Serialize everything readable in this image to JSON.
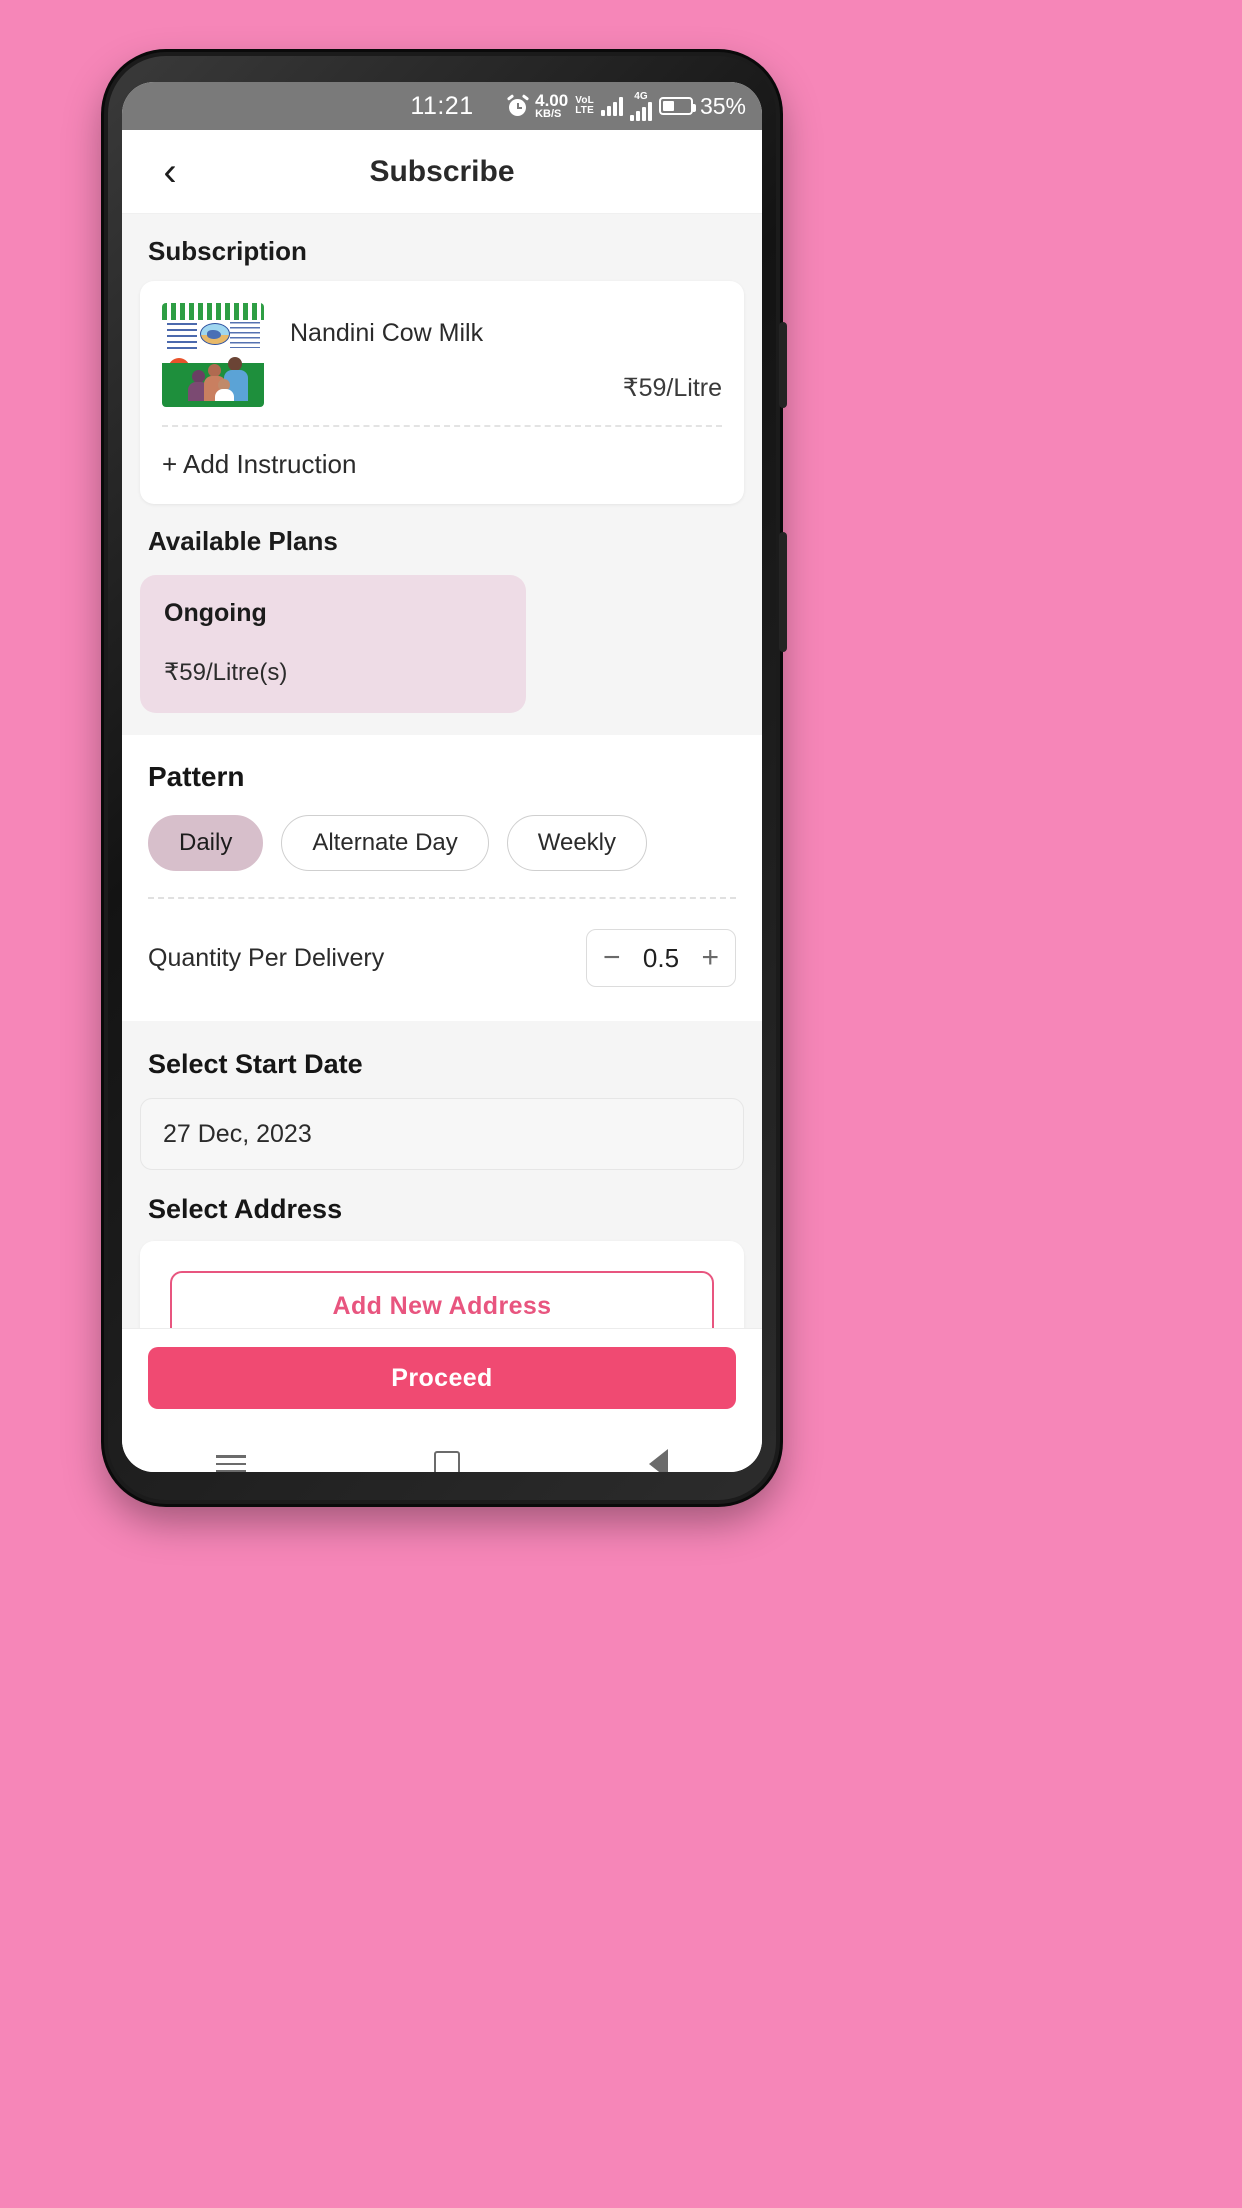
{
  "status_bar": {
    "time": "11:21",
    "alarm_icon": "alarm-clock-icon",
    "data_speed_value": "4.00",
    "data_speed_unit": "KB/S",
    "volte_line1": "VoL",
    "volte_line2": "LTE",
    "signal_icon": "signal-bars-icon",
    "network_type": "4G",
    "battery_icon": "battery-icon",
    "battery_percent": "35%"
  },
  "header": {
    "back_icon": "chevron-left-icon",
    "title": "Subscribe"
  },
  "subscription": {
    "section_title": "Subscription",
    "product": {
      "image_alt": "nandini-milk-packet-image",
      "name": "Nandini Cow Milk",
      "price": "₹59/Litre"
    },
    "add_instruction_label": "+ Add Instruction"
  },
  "available_plans": {
    "section_title": "Available Plans",
    "plans": [
      {
        "name": "Ongoing",
        "price": "₹59/Litre(s)",
        "selected": true
      }
    ]
  },
  "pattern": {
    "section_title": "Pattern",
    "options": [
      {
        "label": "Daily",
        "selected": true
      },
      {
        "label": "Alternate Day",
        "selected": false
      },
      {
        "label": "Weekly",
        "selected": false
      }
    ]
  },
  "quantity": {
    "label": "Quantity Per Delivery",
    "decrement_icon": "minus-icon",
    "value": "0.5",
    "increment_icon": "plus-icon"
  },
  "start_date": {
    "section_title": "Select Start Date",
    "value": "27 Dec, 2023"
  },
  "address": {
    "section_title": "Select Address",
    "add_button_label": "Add New Address"
  },
  "footer": {
    "proceed_label": "Proceed"
  },
  "nav_bar": {
    "recents_icon": "menu-icon",
    "home_icon": "square-home-icon",
    "back_icon": "triangle-back-icon"
  },
  "colors": {
    "page_background": "#F686B8",
    "accent_pink": "#E8557F",
    "proceed_pink": "#F04A72",
    "plan_card_bg": "#EEDCE6",
    "chip_selected_bg": "#D7BFCB",
    "status_bar_bg": "#7A7A7A"
  }
}
